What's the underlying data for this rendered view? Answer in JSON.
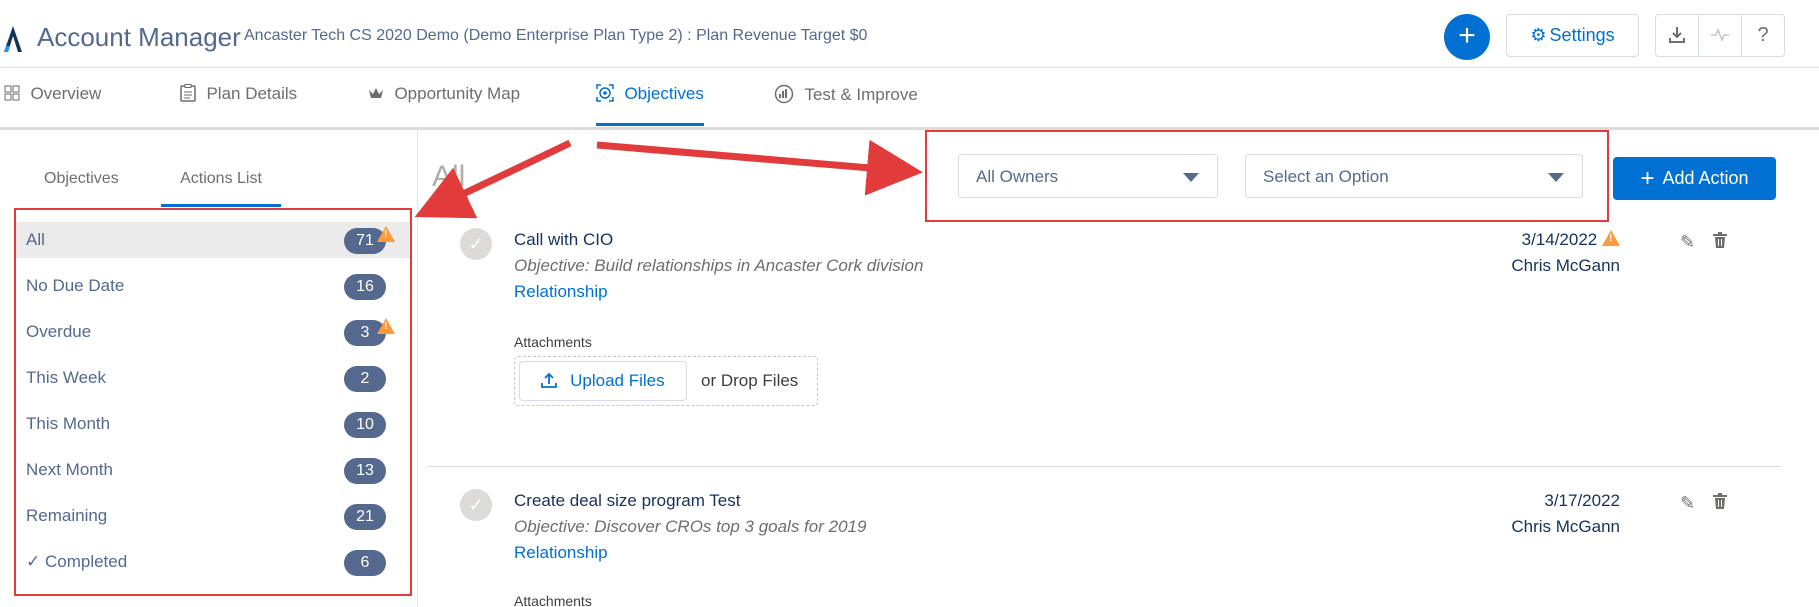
{
  "header": {
    "app_title": "Account Manager",
    "plan_title": "Ancaster Tech CS 2020 Demo (Demo Enterprise Plan Type 2) : Plan Revenue Target $0",
    "add_label": "+",
    "settings_label": "Settings",
    "icons": [
      "download-icon",
      "activity-icon",
      "help-icon"
    ],
    "help_label": "?"
  },
  "tabs": [
    {
      "label": "Overview",
      "icon": "grid-icon"
    },
    {
      "label": "Plan Details",
      "icon": "clipboard-icon"
    },
    {
      "label": "Opportunity Map",
      "icon": "crown-icon"
    },
    {
      "label": "Objectives",
      "icon": "target-icon",
      "active": true
    },
    {
      "label": "Test & Improve",
      "icon": "gauge-icon"
    }
  ],
  "sidebar": {
    "subtabs": [
      {
        "label": "Objectives"
      },
      {
        "label": "Actions List",
        "active": true
      }
    ],
    "items": [
      {
        "label": "All",
        "count": "71",
        "warning": true,
        "selected": true
      },
      {
        "label": "No Due Date",
        "count": "16"
      },
      {
        "label": "Overdue",
        "count": "3",
        "warning": true
      },
      {
        "label": "This Week",
        "count": "2"
      },
      {
        "label": "This Month",
        "count": "10"
      },
      {
        "label": "Next Month",
        "count": "13"
      },
      {
        "label": "Remaining",
        "count": "21"
      },
      {
        "label": "✓ Completed",
        "count": "6"
      }
    ]
  },
  "main": {
    "title": "All",
    "owner_filter": "All Owners",
    "option_filter": "Select an Option",
    "add_action_label": "Add Action",
    "actions": [
      {
        "title": "Call with CIO",
        "objective": "Objective: Build relationships in Ancaster Cork division",
        "category": "Relationship",
        "date": "3/14/2022",
        "date_warning": true,
        "owner": "Chris McGann",
        "attachments_label": "Attachments",
        "upload_label": "Upload Files",
        "drop_label": "or Drop Files"
      },
      {
        "title": "Create deal size program Test",
        "objective": "Objective: Discover CROs top 3 goals for 2019",
        "category": "Relationship",
        "date": "3/17/2022",
        "owner": "Chris McGann",
        "attachments_label": "Attachments"
      }
    ]
  },
  "colors": {
    "accent": "#0070d2",
    "badge": "#54698d",
    "warning": "#ff9a3c",
    "highlight_box": "#e23b3b"
  }
}
